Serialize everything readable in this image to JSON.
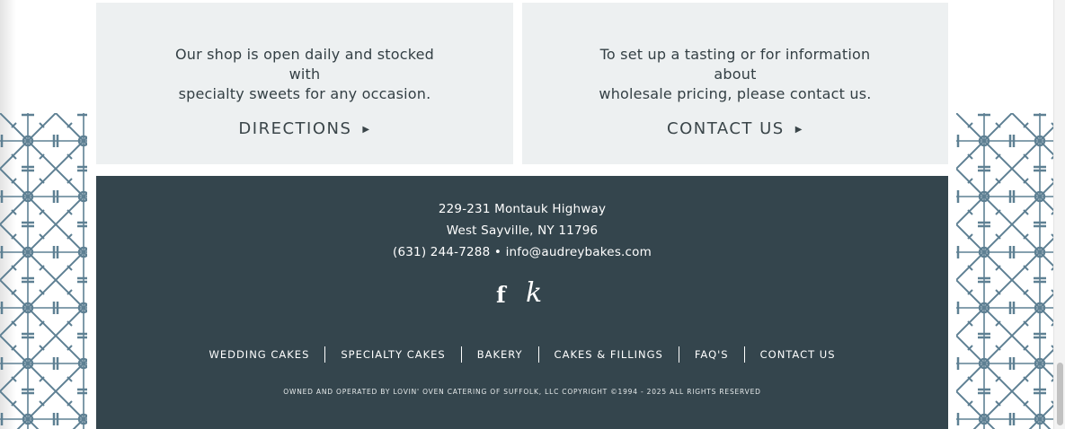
{
  "cards": {
    "shop": {
      "line1": "Our shop is open daily and stocked with",
      "line2": "specialty sweets for any occasion.",
      "link_label": "DIRECTIONS",
      "link_arrow": "▶"
    },
    "contact": {
      "line1": "To set up a tasting or for information about",
      "line2": "wholesale pricing, please contact us.",
      "link_label": "CONTACT US",
      "link_arrow": "▶"
    }
  },
  "footer": {
    "address_line1": "229-231 Montauk Highway",
    "address_line2": "West Sayville, NY 11796",
    "phone": "(631) 244-7288",
    "separator": "•",
    "email": "info@audreybakes.com",
    "social": {
      "facebook_glyph": "f",
      "knot_glyph": "k"
    },
    "nav": [
      {
        "label": "WEDDING CAKES"
      },
      {
        "label": "SPECIALTY CAKES"
      },
      {
        "label": "BAKERY"
      },
      {
        "label": "CAKES & FILLINGS"
      },
      {
        "label": "FAQ'S"
      },
      {
        "label": "CONTACT US"
      }
    ],
    "copyright": "OWNED AND OPERATED BY LOVIN' OVEN CATERING OF SUFFOLK, LLC COPYRIGHT ©1994 - 2025 ALL RIGHTS RESERVED"
  },
  "colors": {
    "footer_bg": "#34454d",
    "card_bg": "#edf0f1",
    "pattern": "#5e8093"
  },
  "icons": {
    "card_arrow": "play-triangle-icon",
    "facebook": "facebook-icon",
    "theknot": "theknot-icon"
  }
}
